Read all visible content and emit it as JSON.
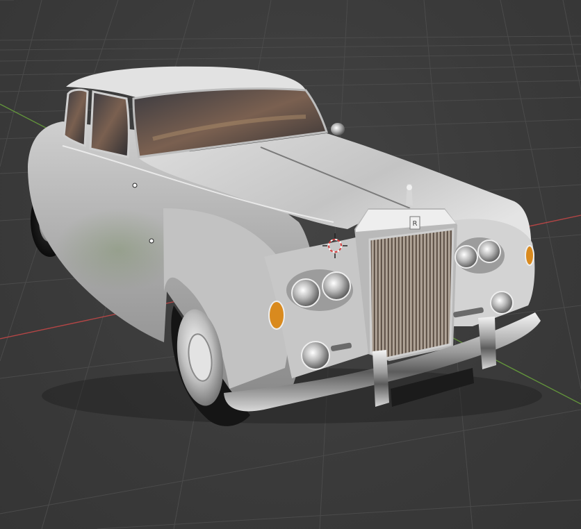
{
  "viewport": {
    "background": "#3d3d3d",
    "grid_color": "#4b4b4b",
    "x_axis_color": "#d04a4a",
    "y_axis_color": "#6fae3f"
  },
  "scene": {
    "object": "vintage-white-sedan",
    "paint_color": "#d9d9d9",
    "chrome_color": "#e6e6e6",
    "indicator_color": "#d98a1e",
    "grille_badge_text": "R",
    "cursor": "3d-cursor-icon"
  }
}
